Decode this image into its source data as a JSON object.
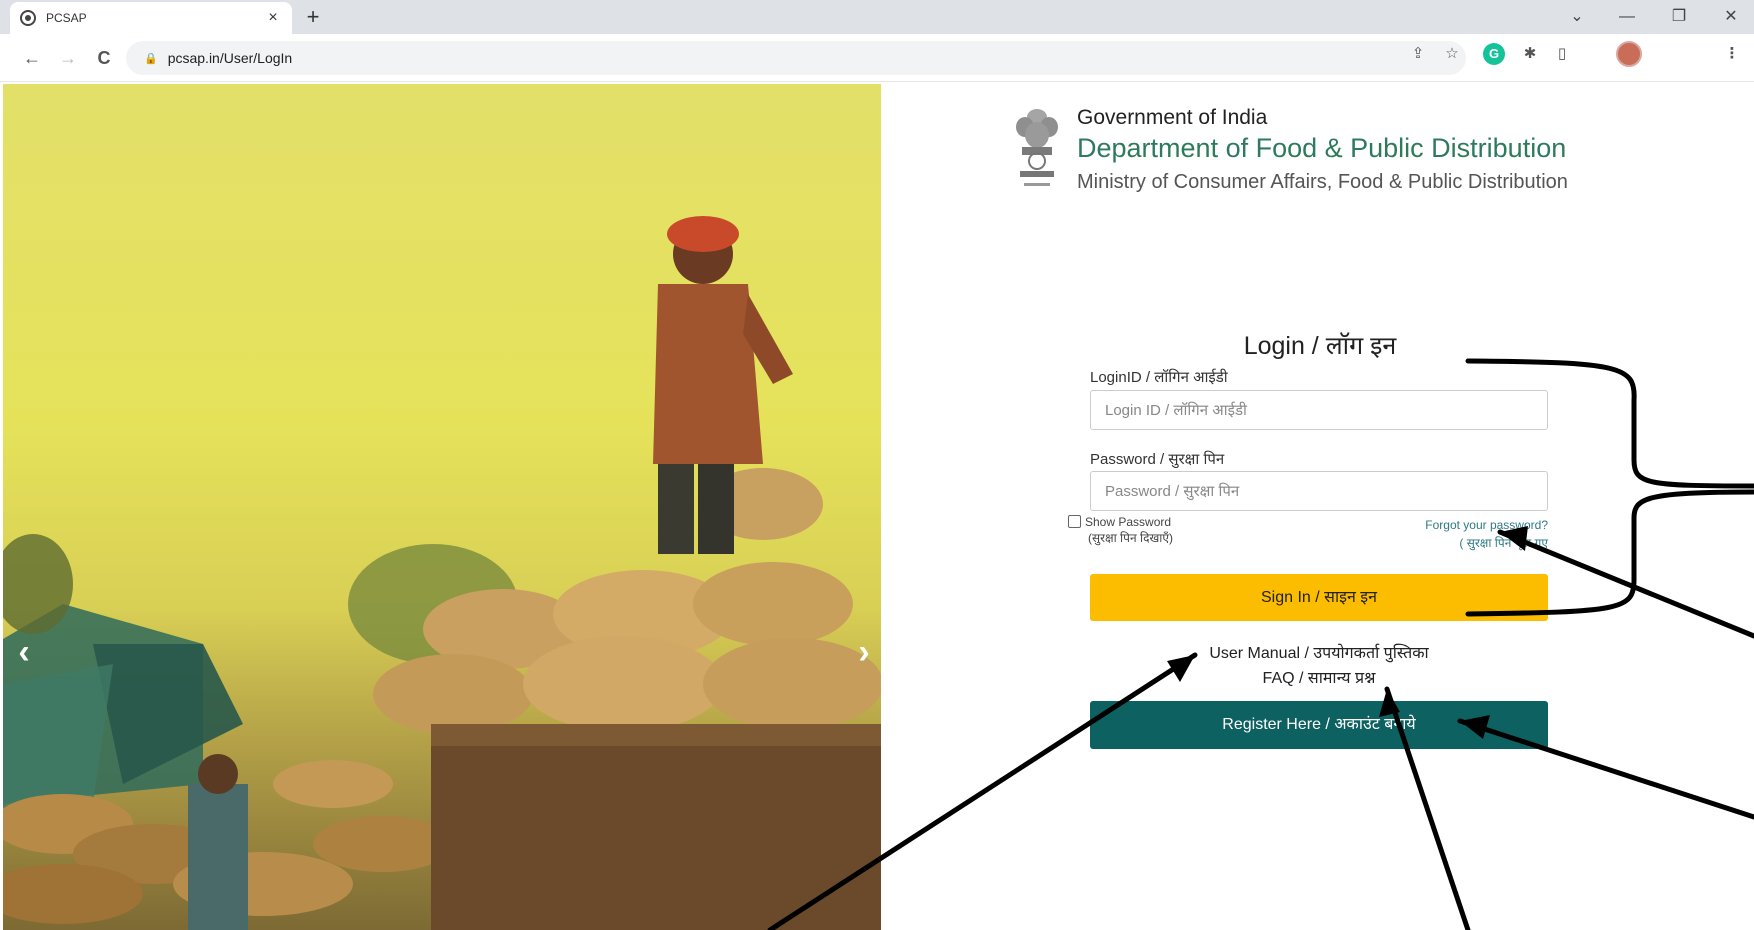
{
  "browser": {
    "tab_title": "PCSAP",
    "tab_close": "×",
    "new_tab": "+",
    "url": "pcsap.in/User/LogIn",
    "minimize": "—",
    "restore": "❐",
    "close": "✕",
    "dropdown": "⌄",
    "back": "←",
    "forward": "→",
    "reload": "C",
    "lock": "🔒",
    "extension_g": "G"
  },
  "header": {
    "gov": "Government of India",
    "department": "Department of Food & Public Distribution",
    "ministry": "Ministry of  Consumer Affairs, Food & Public Distribution"
  },
  "carousel": {
    "prev": "‹",
    "next": "›"
  },
  "login": {
    "title": "Login / लॉग इन",
    "loginid_label": "LoginID / लॉगिन आईडी",
    "loginid_placeholder": "Login ID / लॉगिन आईडी",
    "password_label": "Password / सुरक्षा पिन",
    "password_placeholder": "Password / सुरक्षा पिन",
    "show_password": "Show Password",
    "show_password_hi": "(सुरक्षा पिन दिखाएँ)",
    "forgot": "Forgot your password?",
    "forgot_hi": "( सुरक्षा पिन भूल गए",
    "signin": "Sign In / साइन इन",
    "user_manual": "User Manual / उपयोगकर्ता पुस्तिका",
    "faq": "FAQ / सामान्य प्रश्न",
    "register": "Register Here / अकाउंट बनाये"
  },
  "colors": {
    "signin_bg": "#fcbc00",
    "register_bg": "#0d6161",
    "dept_text": "#2e7a5e"
  }
}
